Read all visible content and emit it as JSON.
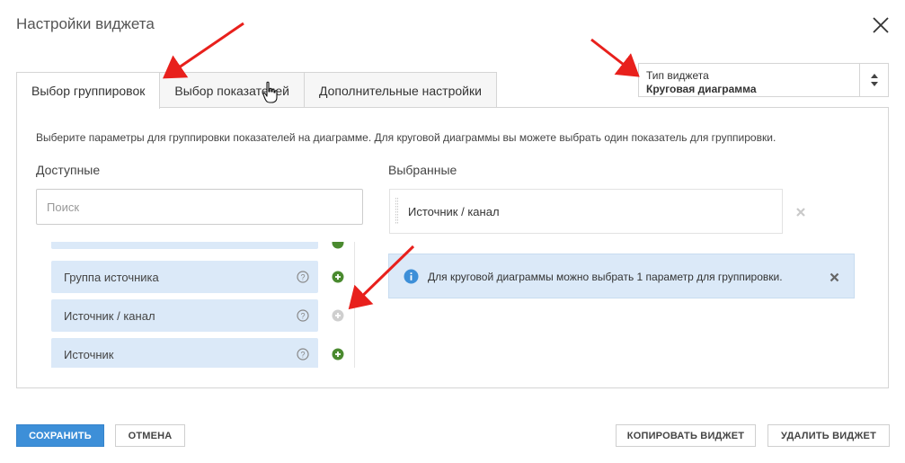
{
  "dialog": {
    "title": "Настройки виджета"
  },
  "tabs": [
    {
      "label": "Выбор группировок",
      "active": true
    },
    {
      "label": "Выбор показателей",
      "active": false
    },
    {
      "label": "Дополнительные настройки",
      "active": false
    }
  ],
  "widget_type": {
    "label": "Тип виджета",
    "value": "Круговая диаграмма"
  },
  "panel": {
    "description": "Выберите параметры для группировки показателей на диаграмме. Для круговой диаграммы вы можете выбрать один показатель для группировки.",
    "available_heading": "Доступные",
    "selected_heading": "Выбранные"
  },
  "search": {
    "placeholder": "Поиск",
    "value": ""
  },
  "available_items": [
    {
      "label": "Группа источника",
      "addable": true
    },
    {
      "label": "Источник / канал",
      "addable": false
    },
    {
      "label": "Источник",
      "addable": true
    }
  ],
  "selected_items": [
    {
      "label": "Источник / канал"
    }
  ],
  "info": {
    "text": "Для круговой диаграммы можно выбрать 1 параметр для группировки."
  },
  "buttons": {
    "save": "СОХРАНИТЬ",
    "cancel": "ОТМЕНА",
    "copy": "КОПИРОВАТЬ ВИДЖЕТ",
    "delete": "УДАЛИТЬ ВИДЖЕТ"
  },
  "colors": {
    "primary": "#3d8fd8",
    "item_bg": "#dbe9f8",
    "add_green": "#4a8a2f",
    "annotation_red": "#e8201c"
  },
  "icons": {
    "close": "close-icon",
    "help": "question-circle-icon",
    "add": "plus-circle-icon",
    "remove": "x-icon",
    "info": "info-circle-icon",
    "select_arrows": "sort-arrows-icon"
  }
}
